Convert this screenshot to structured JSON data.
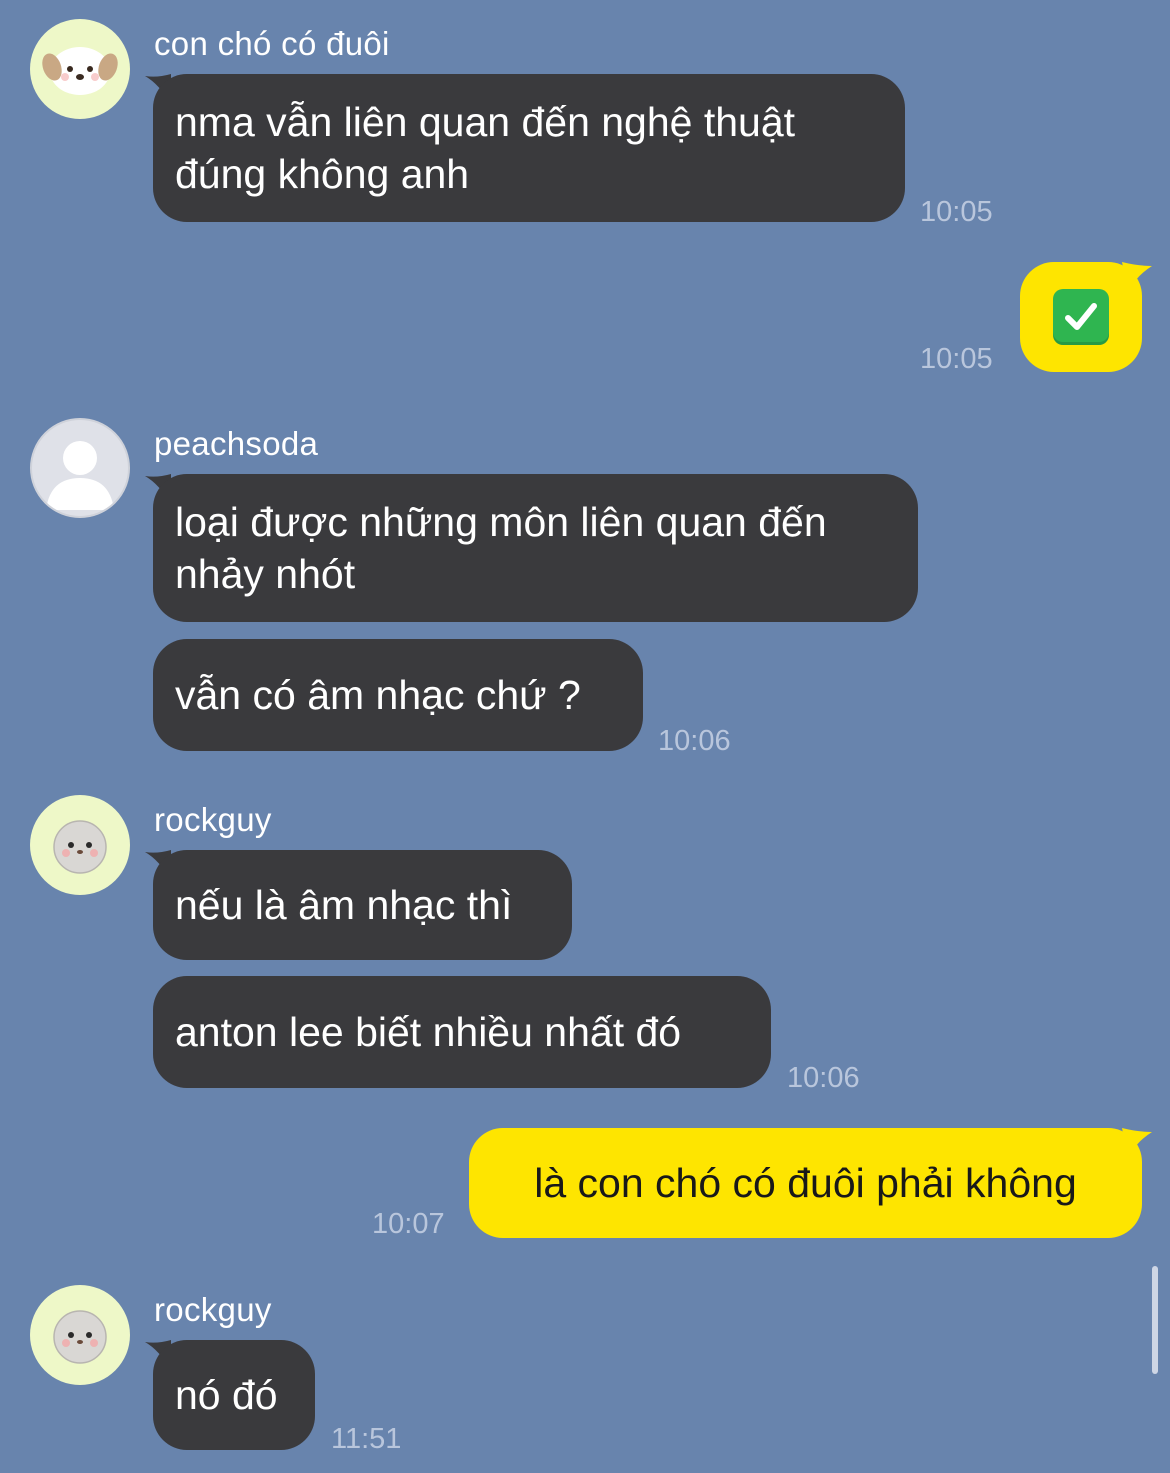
{
  "messages": [
    {
      "sender": "con chó có đuôi",
      "lines": [
        "nma vẫn liên quan đến nghệ thuật",
        "đúng không anh"
      ],
      "time": "10:05"
    },
    {
      "me_emoji": "white-check-mark",
      "time": "10:05"
    },
    {
      "sender": "peachsoda",
      "lines": [
        "loại được những môn liên quan đến",
        "nhảy nhót"
      ]
    },
    {
      "lines": [
        "vẫn có âm nhạc chứ ?"
      ],
      "time": "10:06"
    },
    {
      "sender": "rockguy",
      "lines": [
        "nếu là âm nhạc thì"
      ]
    },
    {
      "lines": [
        "anton lee biết nhiều nhất đó"
      ],
      "time": "10:06"
    },
    {
      "me_text": "là con chó có đuôi phải không",
      "time": "10:07"
    },
    {
      "sender": "rockguy",
      "lines": [
        "nó đó"
      ],
      "time": "11:51"
    }
  ],
  "colors": {
    "background": "#6884ad",
    "incoming_bubble": "#3a3a3d",
    "outgoing_bubble": "#fee500",
    "timestamp": "#b9c6dc"
  }
}
